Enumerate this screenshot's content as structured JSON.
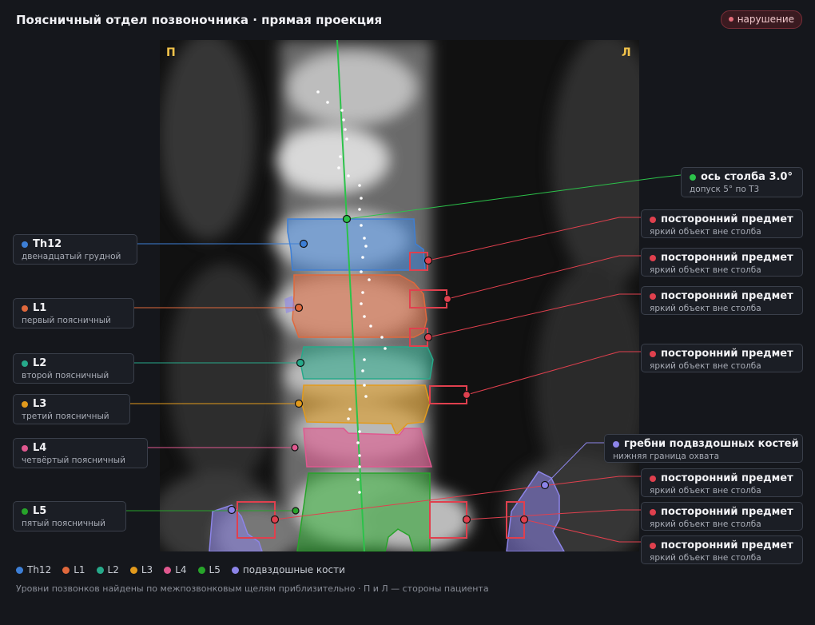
{
  "header": {
    "title": "Поясничный отдел позвоночника · прямая проекция",
    "badge": "нарушение"
  },
  "image": {
    "left_marker": "П",
    "right_marker": "Л"
  },
  "vertebrae": [
    {
      "id": "th12",
      "label": "Th12",
      "sub": "двенадцатый грудной",
      "color": "#3d7fd6"
    },
    {
      "id": "l1",
      "label": "L1",
      "sub": "первый поясничный",
      "color": "#e0683c"
    },
    {
      "id": "l2",
      "label": "L2",
      "sub": "второй поясничный",
      "color": "#26a98a"
    },
    {
      "id": "l3",
      "label": "L3",
      "sub": "третий поясничный",
      "color": "#e29a1c"
    },
    {
      "id": "l4",
      "label": "L4",
      "sub": "четвёртый поясничный",
      "color": "#e0588f"
    },
    {
      "id": "l5",
      "label": "L5",
      "sub": "пятый поясничный",
      "color": "#27a42a"
    }
  ],
  "axis_card": {
    "label": "ось столба 3.0°",
    "sub": "допуск 5° по Т3",
    "color": "#2cc24a"
  },
  "iliac_card": {
    "label": "гребни подвздошных костей",
    "sub": "нижняя граница охвата",
    "color": "#8c84e8"
  },
  "foreign_objects": [
    {
      "label": "посторонний предмет",
      "sub": "яркий объект вне столба"
    },
    {
      "label": "посторонний предмет",
      "sub": "яркий объект вне столба"
    },
    {
      "label": "посторонний предмет",
      "sub": "яркий объект вне столба"
    },
    {
      "label": "посторонний предмет",
      "sub": "яркий объект вне столба"
    },
    {
      "label": "посторонний предмет",
      "sub": "яркий объект вне столба"
    },
    {
      "label": "посторонний предмет",
      "sub": "яркий объект вне столба"
    },
    {
      "label": "посторонний предмет",
      "sub": "яркий объект вне столба"
    }
  ],
  "foreign_color": "#e0404e",
  "legend": [
    {
      "label": "Th12",
      "color": "#3d7fd6"
    },
    {
      "label": "L1",
      "color": "#e0683c"
    },
    {
      "label": "L2",
      "color": "#26a98a"
    },
    {
      "label": "L3",
      "color": "#e29a1c"
    },
    {
      "label": "L4",
      "color": "#e0588f"
    },
    {
      "label": "L5",
      "color": "#27a42a"
    },
    {
      "label": "подвздошные кости",
      "color": "#8c84e8"
    }
  ],
  "footnote": "Уровни позвонков найдены по межпозвонковым щелям приблизительно · П и Л — стороны пациента"
}
